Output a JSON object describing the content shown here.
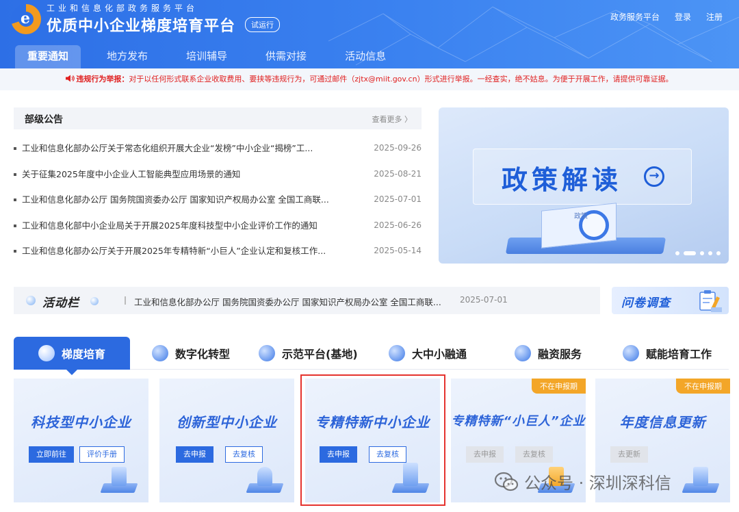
{
  "header": {
    "subtitle": "工业和信息化部政务服务平台",
    "title": "优质中小企业梯度培育平台",
    "trial_badge": "试运行",
    "links": [
      "政务服务平台",
      "登录",
      "注册"
    ],
    "tabs": [
      "重要通知",
      "地方发布",
      "培训辅导",
      "供需对接",
      "活动信息"
    ],
    "active_tab": "重要通知"
  },
  "notice": {
    "label": "违规行为举报：",
    "text": "对于以任何形式联系企业收取费用、要挟等违规行为，可通过邮件（zjtx@miit.gov.cn）形式进行举报。一经查实，绝不姑息。为便于开展工作，请提供可靠证据。"
  },
  "announcements": {
    "title": "部级公告",
    "more": "查看更多 〉",
    "items": [
      {
        "text": "工业和信息化部办公厅关于常态化组织开展大企业“发榜”中小企业“揭榜”工...",
        "date": "2025-09-26"
      },
      {
        "text": "关于征集2025年度中小企业人工智能典型应用场景的通知",
        "date": "2025-08-21"
      },
      {
        "text": "工业和信息化部办公厅 国务院国资委办公厅 国家知识产权局办公室 全国工商联...",
        "date": "2025-07-01"
      },
      {
        "text": "工业和信息化部中小企业局关于开展2025年度科技型中小企业评价工作的通知",
        "date": "2025-06-26"
      },
      {
        "text": "工业和信息化部办公厅关于开展2025年专精特新“小巨人”企业认定和复核工作...",
        "date": "2025-05-14"
      }
    ]
  },
  "banner": {
    "title": "政策解读",
    "book_label": "政策",
    "arrow": "→",
    "slide_count": 5,
    "active_slide": 2
  },
  "activity": {
    "title": "活动栏",
    "text": "工业和信息化部办公厅 国务院国资委办公厅 国家知识产权局办公室 全国工商联...",
    "date": "2025-07-01"
  },
  "survey": {
    "label": "问卷调查"
  },
  "categories": {
    "tabs": [
      "梯度培育",
      "数字化转型",
      "示范平台(基地)",
      "大中小融通",
      "融资服务",
      "赋能培育工作"
    ],
    "active": "梯度培育"
  },
  "cards": [
    {
      "title": "科技型中小企业",
      "buttons": [
        "立即前往",
        "评价手册"
      ],
      "badge": ""
    },
    {
      "title": "创新型中小企业",
      "buttons": [
        "去申报",
        "去复核"
      ],
      "badge": ""
    },
    {
      "title": "专精特新中小企业",
      "buttons": [
        "去申报",
        "去复核"
      ],
      "badge": ""
    },
    {
      "title": "专精特新“小巨人”企业",
      "buttons": [
        "去申报",
        "去复核"
      ],
      "badge": "不在申报期"
    },
    {
      "title": "年度信息更新",
      "buttons": [
        "去更新"
      ],
      "badge": "不在申报期"
    }
  ],
  "watermark": {
    "text": "公众号 · 深圳深科信"
  },
  "colors": {
    "header_blue": "#2d6fe6",
    "accent_blue": "#2c6ae0",
    "notice_red": "#e02020",
    "badge_orange": "#f3a628",
    "highlight_red": "#e5322d"
  }
}
